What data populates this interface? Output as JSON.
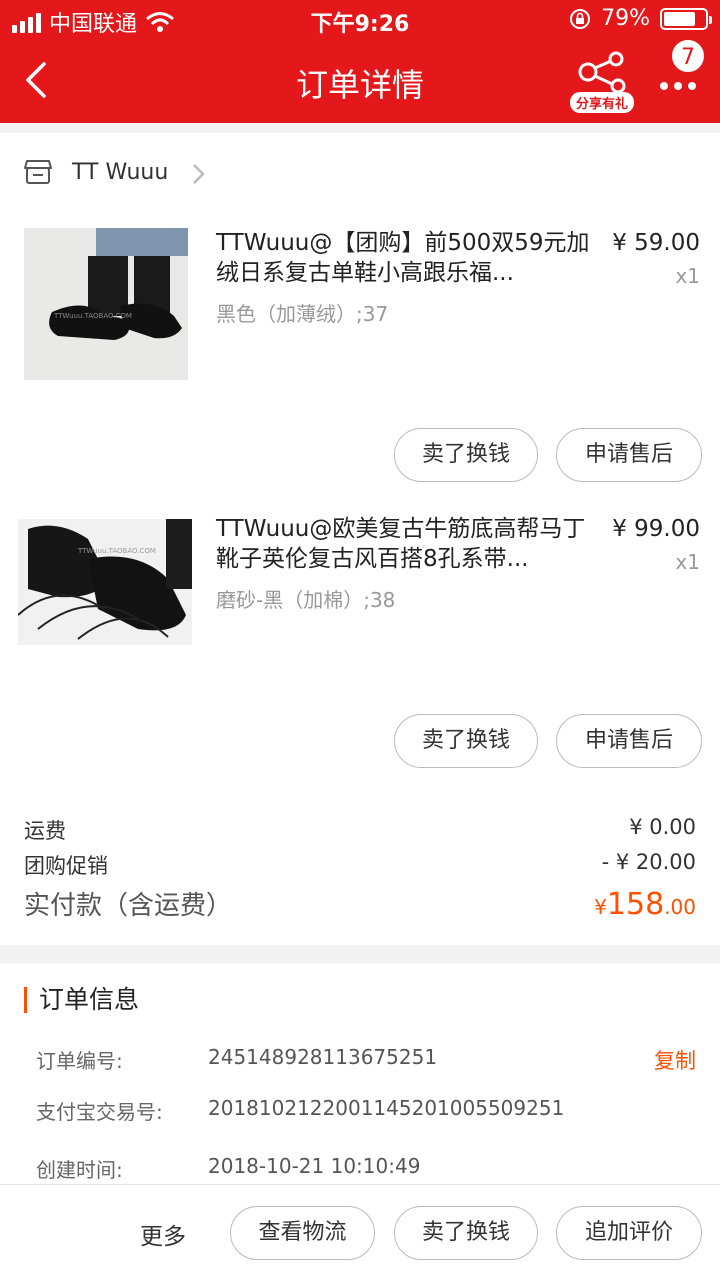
{
  "status": {
    "carrier": "中国联通",
    "time": "下午9:26",
    "battery": "79%",
    "battery_level": 0.79
  },
  "nav": {
    "title": "订单详情",
    "share_label": "分享有礼",
    "badge": "7"
  },
  "shop": {
    "name": "TT Wuuu"
  },
  "items": [
    {
      "title": "TTWuuu@【团购】前500双59元加绒日系复古单鞋小高跟乐福...",
      "sku": "黑色（加薄绒）;37",
      "price": "¥ 59.00",
      "qty": "x1",
      "btn_sell": "卖了换钱",
      "btn_refund": "申请售后"
    },
    {
      "title": "TTWuuu@欧美复古牛筋底高帮马丁靴子英伦复古风百搭8孔系带...",
      "sku": "磨砂-黑（加棉）;38",
      "price": "¥ 99.00",
      "qty": "x1",
      "btn_sell": "卖了换钱",
      "btn_refund": "申请售后"
    }
  ],
  "fees": {
    "shipping_label": "运费",
    "shipping_value": "¥ 0.00",
    "promo_label": "团购促销",
    "promo_value": "- ¥ 20.00",
    "total_label": "实付款（含运费）",
    "total_currency": "¥",
    "total_int": "158",
    "total_dec": ".00"
  },
  "order_info": {
    "title": "订单信息",
    "order_no_label": "订单编号:",
    "order_no": "245148928113675251",
    "copy": "复制",
    "alipay_label": "支付宝交易号:",
    "alipay_no": "2018102122001145201005509251",
    "created_label": "创建时间:",
    "created": "2018-10-21 10:10:49"
  },
  "bottom": {
    "more": "更多",
    "logistics": "查看物流",
    "sell": "卖了换钱",
    "review": "追加评价"
  },
  "colors": {
    "brand_red": "#e4171b",
    "accent_orange": "#ff5000"
  }
}
